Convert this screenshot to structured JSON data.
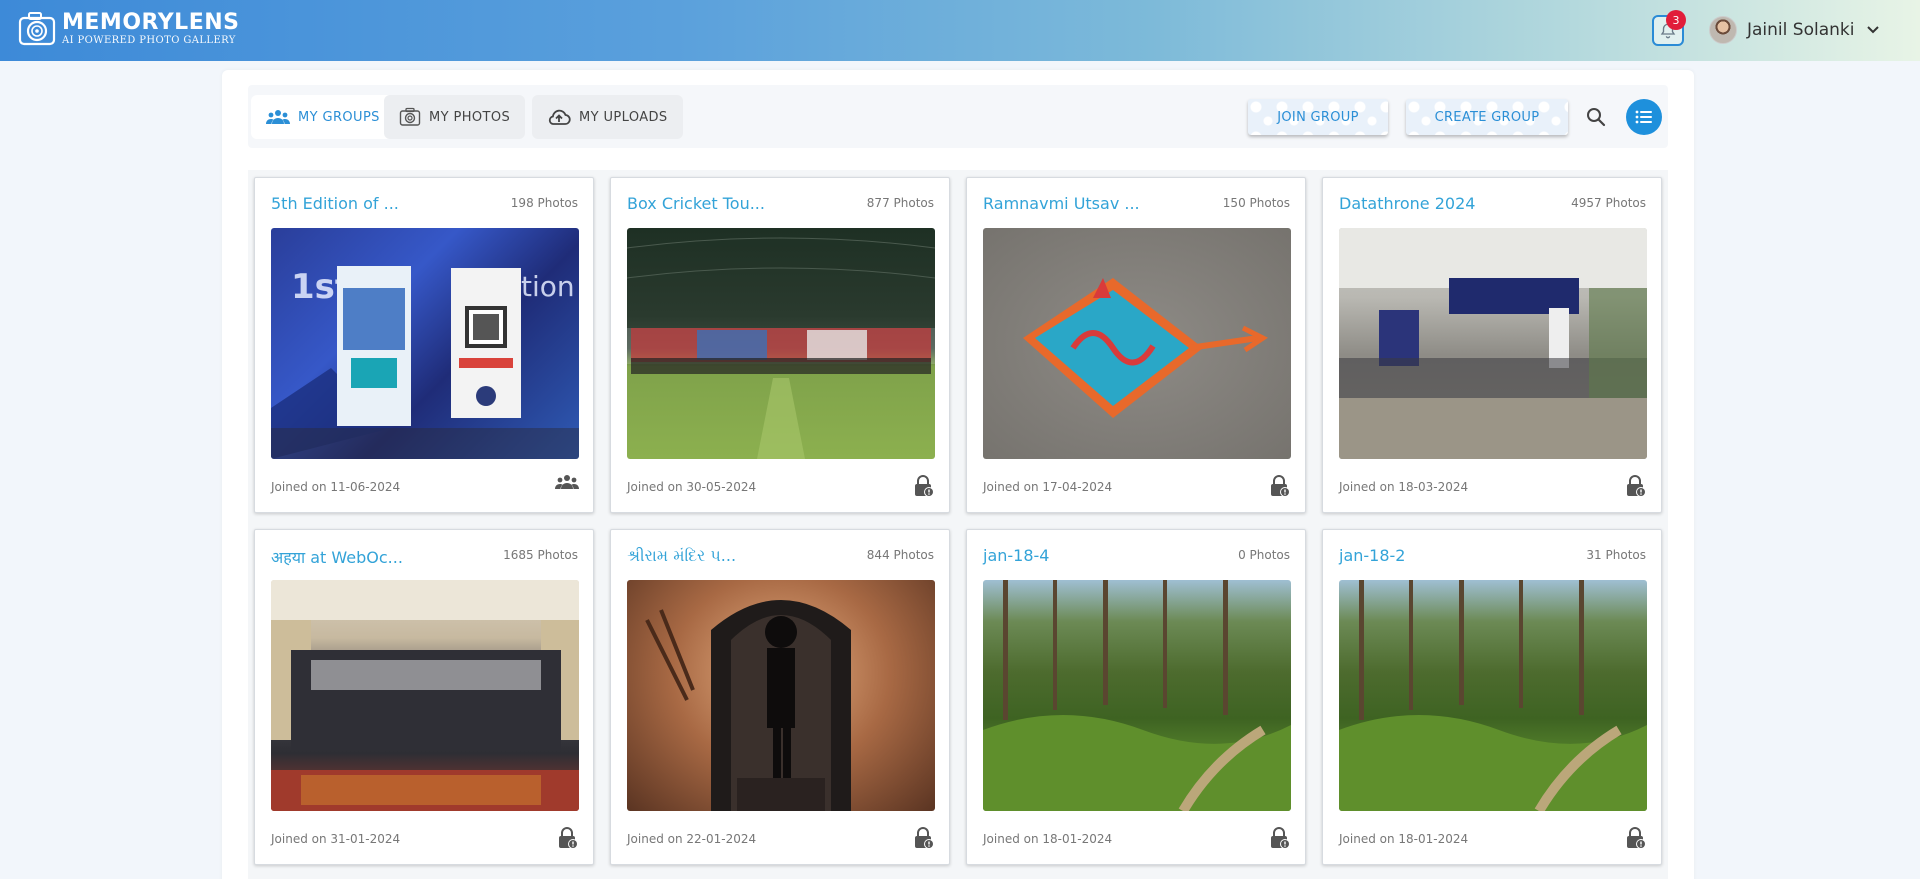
{
  "header": {
    "logo_title": "MEMORYLENS",
    "logo_subtitle": "AI POWERED PHOTO GALLERY",
    "notifications_count": "3",
    "user_name": "Jainil Solanki"
  },
  "toolbar": {
    "tabs": [
      {
        "label": "MY GROUPS",
        "icon": "groups-icon",
        "active": true
      },
      {
        "label": "MY PHOTOS",
        "icon": "camera-icon",
        "active": false
      },
      {
        "label": "MY UPLOADS",
        "icon": "cloud-upload-icon",
        "active": false
      }
    ],
    "join_group_label": "JOIN GROUP",
    "create_group_label": "CREATE GROUP"
  },
  "groups": [
    {
      "title": "5th Edition of ...",
      "count": "198 Photos",
      "joined": "Joined on 11-06-2024",
      "icon": "groups-icon"
    },
    {
      "title": "Box Cricket Tou...",
      "count": "877 Photos",
      "joined": "Joined on 30-05-2024",
      "icon": "lock-icon"
    },
    {
      "title": "Ramnavmi Utsav ...",
      "count": "150 Photos",
      "joined": "Joined on 17-04-2024",
      "icon": "lock-icon"
    },
    {
      "title": "Datathrone 2024",
      "count": "4957 Photos",
      "joined": "Joined on 18-03-2024",
      "icon": "lock-icon"
    },
    {
      "title": "अहया at WebOc...",
      "count": "1685 Photos",
      "joined": "Joined on 31-01-2024",
      "icon": "lock-icon"
    },
    {
      "title": "શ્રીરામ મંદિર પ...",
      "count": "844 Photos",
      "joined": "Joined on 22-01-2024",
      "icon": "lock-icon"
    },
    {
      "title": "jan-18-4",
      "count": "0 Photos",
      "joined": "Joined on 18-01-2024",
      "icon": "lock-icon"
    },
    {
      "title": "jan-18-2",
      "count": "31 Photos",
      "joined": "Joined on 18-01-2024",
      "icon": "lock-icon"
    }
  ],
  "colors": {
    "accent": "#2b8fd6",
    "badge": "#e11d3a",
    "title": "#33a3d8"
  }
}
